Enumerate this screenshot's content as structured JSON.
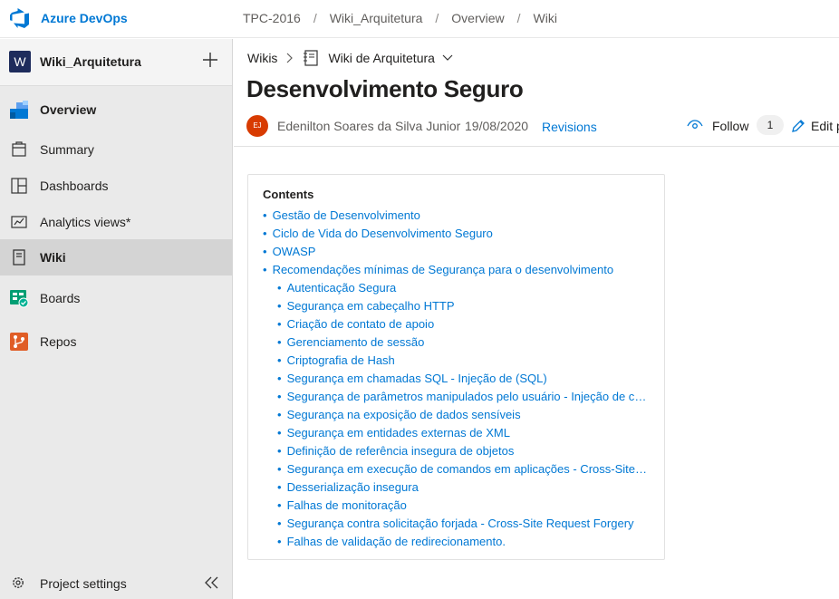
{
  "app": {
    "name": "Azure DevOps"
  },
  "breadcrumb": [
    "TPC-2016",
    "Wiki_Arquitetura",
    "Overview",
    "Wiki"
  ],
  "project": {
    "badge": "W",
    "name": "Wiki_Arquitetura"
  },
  "nav": [
    {
      "label": "Overview",
      "icon": "overview-icon"
    },
    {
      "label": "Summary",
      "icon": "summary-icon"
    },
    {
      "label": "Dashboards",
      "icon": "dashboards-icon"
    },
    {
      "label": "Analytics views*",
      "icon": "analytics-icon"
    },
    {
      "label": "Wiki",
      "icon": "wiki-icon"
    },
    {
      "label": "Boards",
      "icon": "boards-icon"
    },
    {
      "label": "Repos",
      "icon": "repos-icon"
    }
  ],
  "settings": {
    "label": "Project settings"
  },
  "wikibar": {
    "root": "Wikis",
    "wiki_name": "Wiki de Arquitetura"
  },
  "page": {
    "title": "Desenvolvimento Seguro",
    "avatar_initials": "EJ",
    "author": "Edenilton Soares da Silva Junior",
    "date": "19/08/2020",
    "revisions": "Revisions",
    "follow": "Follow",
    "follow_count": "1",
    "edit": "Edit p"
  },
  "toc": {
    "title": "Contents",
    "items": [
      {
        "text": "Gestão de Desenvolvimento",
        "level": 1
      },
      {
        "text": "Ciclo de Vida do Desenvolvimento Seguro",
        "level": 1
      },
      {
        "text": "OWASP",
        "level": 1
      },
      {
        "text": "Recomendações mínimas de Segurança para o desenvolvimento",
        "level": 1
      },
      {
        "text": "Autenticação Segura",
        "level": 2
      },
      {
        "text": "Segurança em cabeçalho HTTP",
        "level": 2
      },
      {
        "text": "Criação de contato de apoio",
        "level": 2
      },
      {
        "text": "Gerenciamento de sessão",
        "level": 2
      },
      {
        "text": "Criptografia de Hash",
        "level": 2
      },
      {
        "text": "Segurança em chamadas SQL - Injeção de (SQL)",
        "level": 2
      },
      {
        "text": "Segurança de parâmetros manipulados pelo usuário - Injeção de código",
        "level": 2
      },
      {
        "text": "Segurança na exposição de dados sensíveis",
        "level": 2
      },
      {
        "text": "Segurança em entidades externas de XML",
        "level": 2
      },
      {
        "text": "Definição de referência insegura de objetos",
        "level": 2
      },
      {
        "text": "Segurança em execução de comandos em aplicações - Cross-Site Scripting",
        "level": 2
      },
      {
        "text": "Desserialização insegura",
        "level": 2
      },
      {
        "text": "Falhas de monitoração",
        "level": 2
      },
      {
        "text": "Segurança contra solicitação forjada - Cross-Site Request Forgery",
        "level": 2
      },
      {
        "text": "Falhas de validação de redirecionamento.",
        "level": 2
      }
    ]
  },
  "colors": {
    "accent": "#0078d4",
    "project_badge": "#1e2c5c",
    "avatar": "#d83b01"
  }
}
